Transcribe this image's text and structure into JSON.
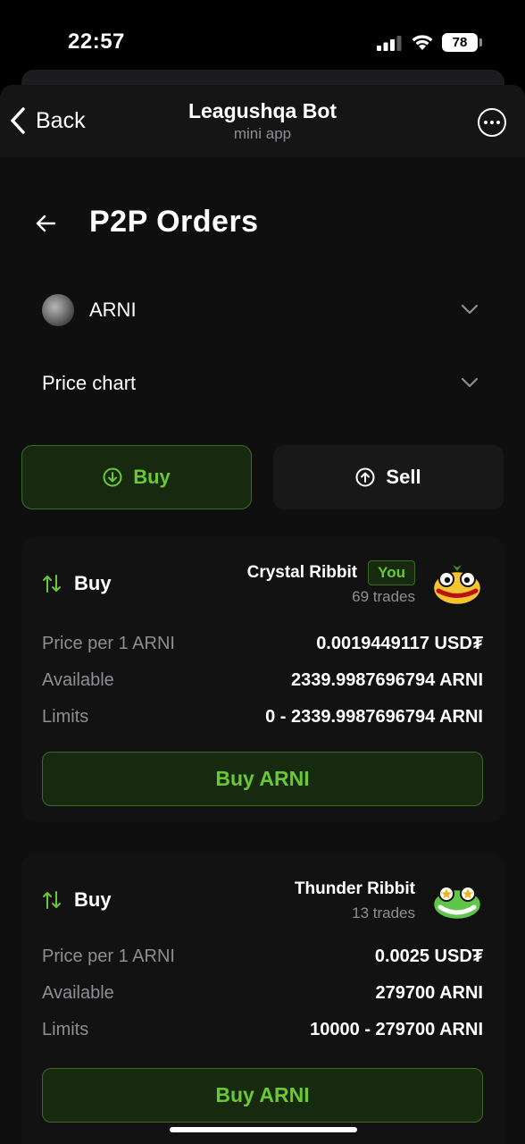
{
  "status_bar": {
    "time": "22:57",
    "battery": "78"
  },
  "telegram": {
    "back_label": "Back",
    "title": "Leagushqa Bot",
    "subtitle": "mini app"
  },
  "page": {
    "title": "P2P Orders"
  },
  "token_select": {
    "label": "ARNI"
  },
  "price_chart": {
    "label": "Price chart"
  },
  "tabs": {
    "buy": "Buy",
    "sell": "Sell",
    "active": "buy"
  },
  "orders": [
    {
      "side": "Buy",
      "seller": "Crystal Ribbit",
      "badge": "You",
      "trades": "69 trades",
      "rows": [
        {
          "key": "Price per 1 ARNI",
          "value": "0.0019449117 USD₮"
        },
        {
          "key": "Available",
          "value": "2339.9987696794 ARNI"
        },
        {
          "key": "Limits",
          "value": "0 - 2339.9987696794 ARNI"
        }
      ],
      "action": "Buy ARNI"
    },
    {
      "side": "Buy",
      "seller": "Thunder Ribbit",
      "badge": "",
      "trades": "13 trades",
      "rows": [
        {
          "key": "Price per 1 ARNI",
          "value": "0.0025 USD₮"
        },
        {
          "key": "Available",
          "value": "279700 ARNI"
        },
        {
          "key": "Limits",
          "value": "10000 - 279700 ARNI"
        }
      ],
      "action": "Buy ARNI"
    }
  ],
  "colors": {
    "accent_green": "#69c934",
    "green_bg": "#17290f",
    "card_bg": "#121212",
    "muted": "#8e8e93"
  }
}
